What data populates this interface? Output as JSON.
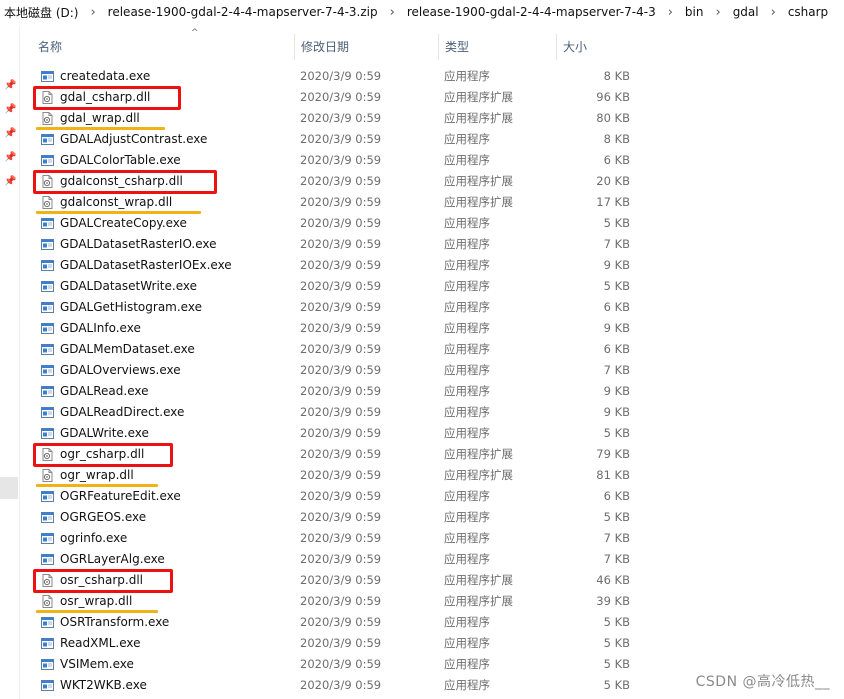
{
  "breadcrumb": [
    "本地磁盘 (D:)",
    "release-1900-gdal-2-4-4-mapserver-7-4-3.zip",
    "release-1900-gdal-2-4-4-mapserver-7-4-3",
    "bin",
    "gdal",
    "csharp"
  ],
  "columns": {
    "name": "名称",
    "date": "修改日期",
    "type": "类型",
    "size": "大小"
  },
  "files": [
    {
      "name": "createdata.exe",
      "date": "2020/3/9 0:59",
      "type": "应用程序",
      "size": "8 KB",
      "icon": "exe-icon"
    },
    {
      "name": "gdal_csharp.dll",
      "date": "2020/3/9 0:59",
      "type": "应用程序扩展",
      "size": "96 KB",
      "icon": "dll-icon"
    },
    {
      "name": "gdal_wrap.dll",
      "date": "2020/3/9 0:59",
      "type": "应用程序扩展",
      "size": "80 KB",
      "icon": "dll-icon"
    },
    {
      "name": "GDALAdjustContrast.exe",
      "date": "2020/3/9 0:59",
      "type": "应用程序",
      "size": "8 KB",
      "icon": "exe-icon"
    },
    {
      "name": "GDALColorTable.exe",
      "date": "2020/3/9 0:59",
      "type": "应用程序",
      "size": "6 KB",
      "icon": "exe-icon"
    },
    {
      "name": "gdalconst_csharp.dll",
      "date": "2020/3/9 0:59",
      "type": "应用程序扩展",
      "size": "20 KB",
      "icon": "dll-icon"
    },
    {
      "name": "gdalconst_wrap.dll",
      "date": "2020/3/9 0:59",
      "type": "应用程序扩展",
      "size": "17 KB",
      "icon": "dll-icon"
    },
    {
      "name": "GDALCreateCopy.exe",
      "date": "2020/3/9 0:59",
      "type": "应用程序",
      "size": "5 KB",
      "icon": "exe-icon"
    },
    {
      "name": "GDALDatasetRasterIO.exe",
      "date": "2020/3/9 0:59",
      "type": "应用程序",
      "size": "7 KB",
      "icon": "exe-icon"
    },
    {
      "name": "GDALDatasetRasterIOEx.exe",
      "date": "2020/3/9 0:59",
      "type": "应用程序",
      "size": "9 KB",
      "icon": "exe-icon"
    },
    {
      "name": "GDALDatasetWrite.exe",
      "date": "2020/3/9 0:59",
      "type": "应用程序",
      "size": "5 KB",
      "icon": "exe-icon"
    },
    {
      "name": "GDALGetHistogram.exe",
      "date": "2020/3/9 0:59",
      "type": "应用程序",
      "size": "6 KB",
      "icon": "exe-icon"
    },
    {
      "name": "GDALInfo.exe",
      "date": "2020/3/9 0:59",
      "type": "应用程序",
      "size": "9 KB",
      "icon": "exe-icon"
    },
    {
      "name": "GDALMemDataset.exe",
      "date": "2020/3/9 0:59",
      "type": "应用程序",
      "size": "6 KB",
      "icon": "exe-icon"
    },
    {
      "name": "GDALOverviews.exe",
      "date": "2020/3/9 0:59",
      "type": "应用程序",
      "size": "7 KB",
      "icon": "exe-icon"
    },
    {
      "name": "GDALRead.exe",
      "date": "2020/3/9 0:59",
      "type": "应用程序",
      "size": "9 KB",
      "icon": "exe-icon"
    },
    {
      "name": "GDALReadDirect.exe",
      "date": "2020/3/9 0:59",
      "type": "应用程序",
      "size": "9 KB",
      "icon": "exe-icon"
    },
    {
      "name": "GDALWrite.exe",
      "date": "2020/3/9 0:59",
      "type": "应用程序",
      "size": "5 KB",
      "icon": "exe-icon"
    },
    {
      "name": "ogr_csharp.dll",
      "date": "2020/3/9 0:59",
      "type": "应用程序扩展",
      "size": "79 KB",
      "icon": "dll-icon"
    },
    {
      "name": "ogr_wrap.dll",
      "date": "2020/3/9 0:59",
      "type": "应用程序扩展",
      "size": "81 KB",
      "icon": "dll-icon"
    },
    {
      "name": "OGRFeatureEdit.exe",
      "date": "2020/3/9 0:59",
      "type": "应用程序",
      "size": "6 KB",
      "icon": "exe-icon"
    },
    {
      "name": "OGRGEOS.exe",
      "date": "2020/3/9 0:59",
      "type": "应用程序",
      "size": "5 KB",
      "icon": "exe-icon"
    },
    {
      "name": "ogrinfo.exe",
      "date": "2020/3/9 0:59",
      "type": "应用程序",
      "size": "7 KB",
      "icon": "exe-icon"
    },
    {
      "name": "OGRLayerAlg.exe",
      "date": "2020/3/9 0:59",
      "type": "应用程序",
      "size": "7 KB",
      "icon": "exe-icon"
    },
    {
      "name": "osr_csharp.dll",
      "date": "2020/3/9 0:59",
      "type": "应用程序扩展",
      "size": "46 KB",
      "icon": "dll-icon"
    },
    {
      "name": "osr_wrap.dll",
      "date": "2020/3/9 0:59",
      "type": "应用程序扩展",
      "size": "39 KB",
      "icon": "dll-icon"
    },
    {
      "name": "OSRTransform.exe",
      "date": "2020/3/9 0:59",
      "type": "应用程序",
      "size": "5 KB",
      "icon": "exe-icon"
    },
    {
      "name": "ReadXML.exe",
      "date": "2020/3/9 0:59",
      "type": "应用程序",
      "size": "5 KB",
      "icon": "exe-icon"
    },
    {
      "name": "VSIMem.exe",
      "date": "2020/3/9 0:59",
      "type": "应用程序",
      "size": "5 KB",
      "icon": "exe-icon"
    },
    {
      "name": "WKT2WKB.exe",
      "date": "2020/3/9 0:59",
      "type": "应用程序",
      "size": "5 KB",
      "icon": "exe-icon"
    }
  ],
  "annotations": {
    "red_box_rows": [
      1,
      5,
      18,
      24
    ],
    "gold_underline_rows": [
      2,
      6,
      19,
      25
    ],
    "red_color": "#ee1111",
    "gold_color": "#f0b216"
  },
  "watermark": "CSDN @高冷低热__"
}
